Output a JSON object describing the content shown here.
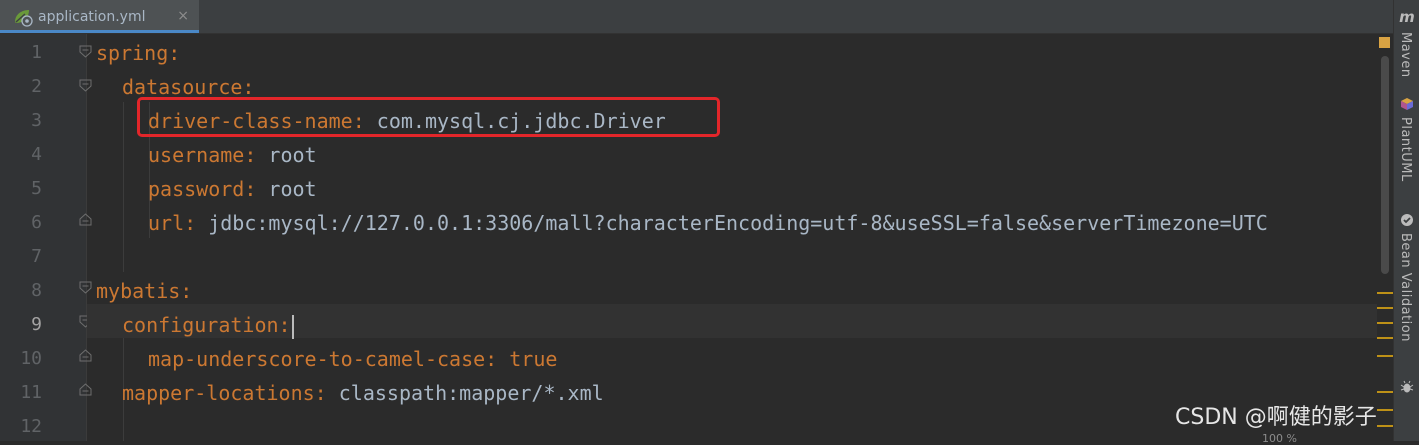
{
  "tab": {
    "filename": "application.yml",
    "icon": "spring-leaf-icon",
    "close": "×"
  },
  "editor": {
    "current_line": 9,
    "lines": [
      {
        "num": "1",
        "key": "spring",
        "colon": ":",
        "value": ""
      },
      {
        "num": "2",
        "key": "datasource",
        "colon": ":",
        "value": ""
      },
      {
        "num": "3",
        "key": "driver-class-name",
        "colon": ": ",
        "value": "com.mysql.cj.jdbc.Driver"
      },
      {
        "num": "4",
        "key": "username",
        "colon": ": ",
        "value": "root"
      },
      {
        "num": "5",
        "key": "password",
        "colon": ": ",
        "value": "root"
      },
      {
        "num": "6",
        "key": "url",
        "colon": ": ",
        "value": "jdbc:mysql://127.0.0.1:3306/mall?characterEncoding=utf-8&useSSL=false&serverTimezone=UTC"
      },
      {
        "num": "7",
        "key": "",
        "colon": "",
        "value": ""
      },
      {
        "num": "8",
        "key": "mybatis",
        "colon": ":",
        "value": ""
      },
      {
        "num": "9",
        "key": "configuration",
        "colon": ":",
        "value": ""
      },
      {
        "num": "10",
        "key": "map-underscore-to-camel-case",
        "colon": ": ",
        "value": "true"
      },
      {
        "num": "11",
        "key": "mapper-locations",
        "colon": ": ",
        "value": "classpath:mapper/*.xml"
      },
      {
        "num": "12",
        "key": "",
        "colon": "",
        "value": ""
      }
    ]
  },
  "right_toolbar": {
    "maven_icon": "m",
    "maven": "Maven",
    "plantuml": "PlantUML",
    "bean_validation": "Bean Validation"
  },
  "watermark": "CSDN @啊健的影子",
  "zoom": "100 %",
  "colors": {
    "keyword_orange": "#cc7832",
    "text": "#a9b7c6",
    "background": "#2b2b2b",
    "highlight_red": "#e3262a"
  }
}
